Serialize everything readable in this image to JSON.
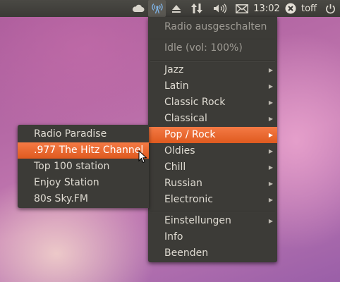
{
  "topbar": {
    "icons": [
      "cloud-icon",
      "radio-tray-icon",
      "eject-icon",
      "network-transfer-icon",
      "volume-icon",
      "mail-icon",
      "close-circle-icon",
      "power-icon"
    ],
    "clock": "13:02",
    "user": "toff"
  },
  "main_menu": {
    "status_items": [
      "Radio ausgeschalten",
      "Idle (vol: 100%)"
    ],
    "categories": [
      "Jazz",
      "Latin",
      "Classic Rock",
      "Classical",
      "Pop / Rock",
      "Oldies",
      "Chill",
      "Russian",
      "Electronic"
    ],
    "highlighted": "Pop / Rock",
    "bottom_items": [
      "Einstellungen",
      "Info",
      "Beenden"
    ]
  },
  "sub_menu": {
    "items": [
      "Radio Paradise",
      ".977 The Hitz Channel",
      "Top 100 station",
      "Enjoy Station",
      "80s Sky.FM"
    ],
    "highlighted": ".977 The Hitz Channel"
  },
  "colors": {
    "highlight": "#f0703a",
    "menu_bg": "#3c3b37",
    "panel_bg": "#3b3a36"
  }
}
